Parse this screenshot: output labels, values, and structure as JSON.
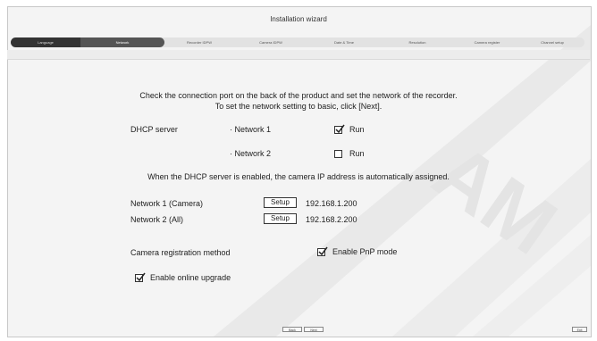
{
  "window": {
    "title": "Installation wizard"
  },
  "steps": [
    {
      "label": "Language"
    },
    {
      "label": "Network"
    },
    {
      "label": "Recorder IDPW"
    },
    {
      "label": "Camera IDPW"
    },
    {
      "label": "Date & Time"
    },
    {
      "label": "Resolution"
    },
    {
      "label": "Camera register"
    },
    {
      "label": "Channel setup"
    }
  ],
  "intro": {
    "line1": "Check the connection port on the back of the product and set the network of the recorder.",
    "line2": "To set the network setting to basic, click [Next]."
  },
  "dhcp": {
    "label": "DHCP server",
    "net1_label": "· Network 1",
    "net1_run_label": "Run",
    "net1_run_checked": true,
    "net2_label": "· Network 2",
    "net2_run_label": "Run",
    "net2_run_checked": false,
    "note": "When the DHCP server is enabled, the camera IP address is automatically assigned."
  },
  "networks": [
    {
      "label": "Network 1 (Camera)",
      "button": "Setup",
      "ip": "192.168.1.200"
    },
    {
      "label": "Network 2 (All)",
      "button": "Setup",
      "ip": "192.168.2.200"
    }
  ],
  "registration": {
    "label": "Camera registration method",
    "pnp_label": "Enable PnP mode",
    "pnp_checked": true
  },
  "upgrade": {
    "label": "Enable online upgrade",
    "checked": true
  },
  "footer": {
    "back": "Back",
    "next": "Next",
    "exit": "Exit"
  },
  "colors": {
    "step_done": "#333333",
    "step_current": "#555555",
    "watermark": "#e6e6e6"
  }
}
